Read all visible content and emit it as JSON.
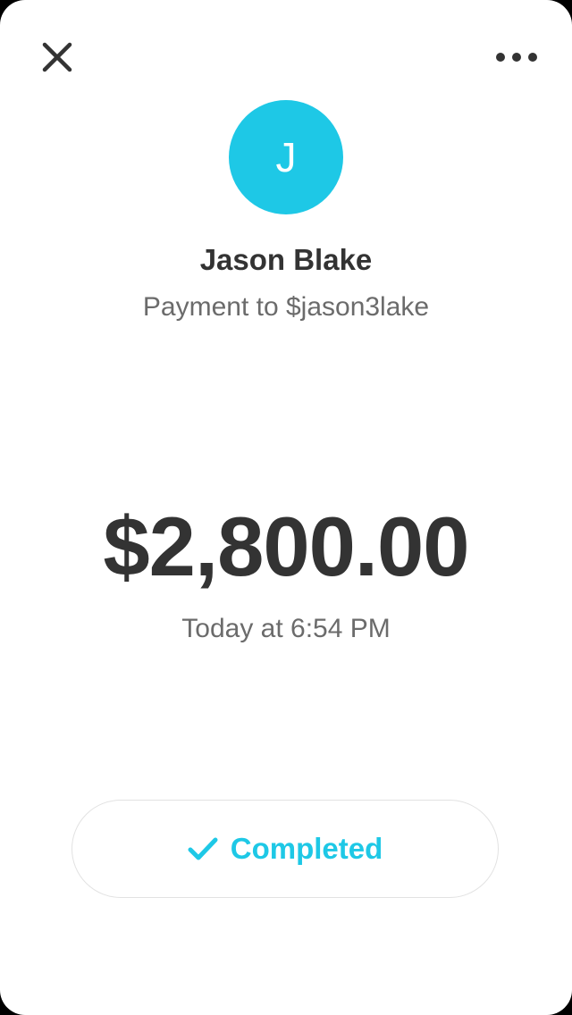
{
  "header": {
    "close_icon": "close-icon",
    "more_icon": "more-horizontal-icon"
  },
  "recipient": {
    "avatar_initial": "J",
    "name": "Jason Blake",
    "subtitle": "Payment to $jason3lake"
  },
  "payment": {
    "amount": "$2,800.00",
    "timestamp": "Today at 6:54 PM"
  },
  "status": {
    "icon": "checkmark-icon",
    "label": "Completed"
  },
  "colors": {
    "accent": "#1ec8e6",
    "text_primary": "#333333",
    "text_secondary": "#6b6b6b",
    "background": "#ffffff"
  }
}
